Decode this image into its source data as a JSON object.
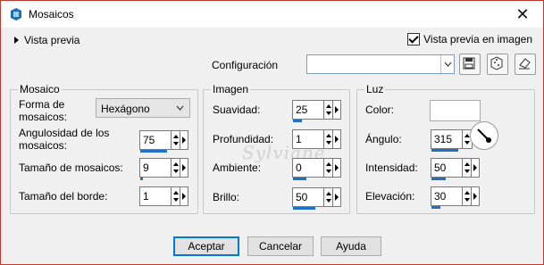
{
  "window": {
    "title": "Mosaicos",
    "close_icon": "close-icon"
  },
  "top": {
    "preview_label": "Vista previa",
    "preview_image_label": "Vista previa en imagen",
    "preview_image_checked": true,
    "config_label": "Configuración",
    "config_value": ""
  },
  "mosaico": {
    "title": "Mosaico",
    "shape_label": "Forma de mosaicos:",
    "shape_value": "Hexágono",
    "angularity_label": "Angulosidad de los mosaicos:",
    "angularity_value": "75",
    "size_label": "Tamaño de mosaicos:",
    "size_value": "9",
    "border_label": "Tamaño del borde:",
    "border_value": "1"
  },
  "imagen": {
    "title": "Imagen",
    "smooth_label": "Suavidad:",
    "smooth_value": "25",
    "depth_label": "Profundidad:",
    "depth_value": "1",
    "ambient_label": "Ambiente:",
    "ambient_value": "0",
    "bright_label": "Brillo:",
    "bright_value": "50"
  },
  "luz": {
    "title": "Luz",
    "color_label": "Color:",
    "color_value": "#ffffff",
    "angle_label": "Ángulo:",
    "angle_value": "315",
    "intensity_label": "Intensidad:",
    "intensity_value": "50",
    "elevation_label": "Elevación:",
    "elevation_value": "30"
  },
  "buttons": {
    "accept": "Aceptar",
    "cancel": "Cancelar",
    "help": "Ayuda"
  },
  "watermark": "Sylviane",
  "colors": {
    "accent": "#1e73c9",
    "window_border": "#c0392b"
  }
}
